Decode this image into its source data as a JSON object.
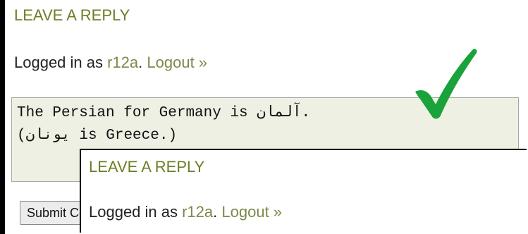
{
  "back_panel": {
    "heading": "LEAVE A REPLY",
    "logged_in_prefix": "Logged in as ",
    "username": "r12a",
    "separator": ". ",
    "logout_label": "Logout »",
    "comment_value": "The Persian for Germany is آلمان.\n(یونان is Greece.)",
    "submit_label": "Submit Comment"
  },
  "front_panel": {
    "heading": "LEAVE A REPLY",
    "logged_in_prefix": "Logged in as ",
    "username": "r12a",
    "separator": ". ",
    "logout_label": "Logout »"
  },
  "icons": {
    "check": "check-mark-icon"
  },
  "colors": {
    "heading": "#6b7f25",
    "link": "#7a8a4a",
    "check": "#1aa33a",
    "textarea_bg": "#eef0e4",
    "frame": "#000000"
  }
}
